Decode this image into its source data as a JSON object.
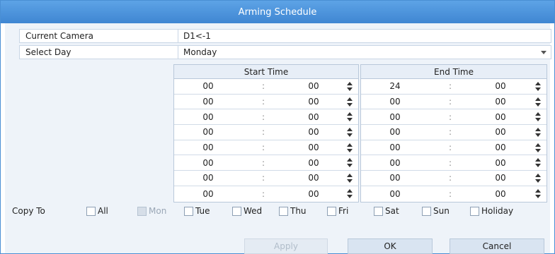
{
  "dialog": {
    "title": "Arming Schedule"
  },
  "info": {
    "camera_label": "Current Camera",
    "camera_value": "D1<-1",
    "day_label": "Select Day",
    "day_value": "Monday"
  },
  "schedule": {
    "start_header": "Start Time",
    "end_header": "End Time",
    "separator": ":",
    "rows": [
      {
        "start_h": "00",
        "start_m": "00",
        "end_h": "24",
        "end_m": "00"
      },
      {
        "start_h": "00",
        "start_m": "00",
        "end_h": "00",
        "end_m": "00"
      },
      {
        "start_h": "00",
        "start_m": "00",
        "end_h": "00",
        "end_m": "00"
      },
      {
        "start_h": "00",
        "start_m": "00",
        "end_h": "00",
        "end_m": "00"
      },
      {
        "start_h": "00",
        "start_m": "00",
        "end_h": "00",
        "end_m": "00"
      },
      {
        "start_h": "00",
        "start_m": "00",
        "end_h": "00",
        "end_m": "00"
      },
      {
        "start_h": "00",
        "start_m": "00",
        "end_h": "00",
        "end_m": "00"
      },
      {
        "start_h": "00",
        "start_m": "00",
        "end_h": "00",
        "end_m": "00"
      }
    ]
  },
  "copy_to": {
    "label": "Copy To",
    "options": [
      {
        "label": "All",
        "checked": false,
        "disabled": false
      },
      {
        "label": "Mon",
        "checked": false,
        "disabled": true
      },
      {
        "label": "Tue",
        "checked": false,
        "disabled": false
      },
      {
        "label": "Wed",
        "checked": false,
        "disabled": false
      },
      {
        "label": "Thu",
        "checked": false,
        "disabled": false
      },
      {
        "label": "Fri",
        "checked": false,
        "disabled": false
      },
      {
        "label": "Sat",
        "checked": false,
        "disabled": false
      },
      {
        "label": "Sun",
        "checked": false,
        "disabled": false
      },
      {
        "label": "Holiday",
        "checked": false,
        "disabled": false
      }
    ]
  },
  "buttons": {
    "apply": "Apply",
    "ok": "OK",
    "cancel": "Cancel"
  },
  "colors": {
    "titlebar": "#4a94dc",
    "body": "#eef3f9",
    "button": "#d9e4f1"
  }
}
